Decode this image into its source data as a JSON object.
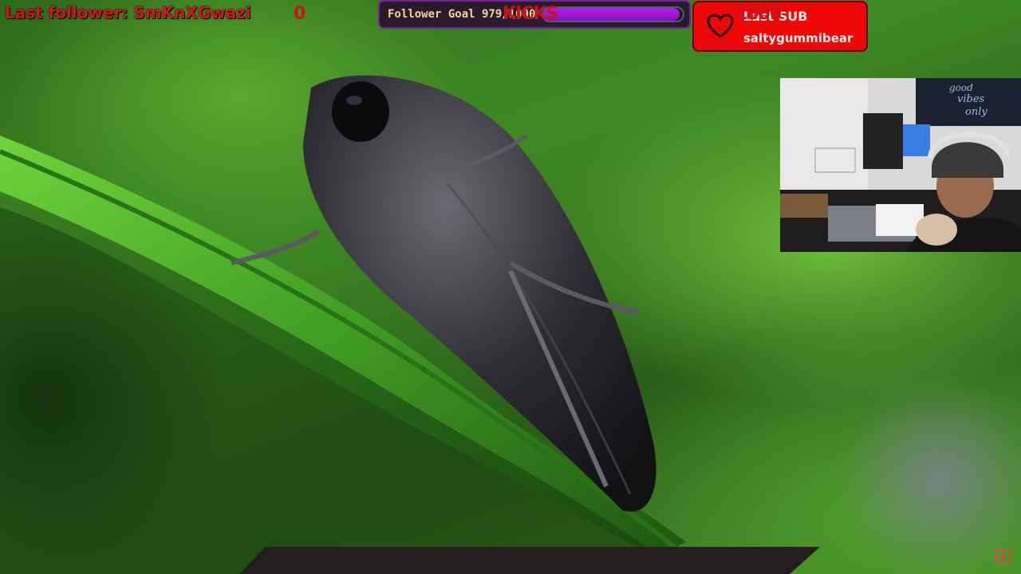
{
  "overlay": {
    "last_follower": "Last follower: SmKnXGwazi",
    "follower_goal": {
      "label": "Follower Goal 979/1000",
      "current": 979,
      "target": 1000,
      "progress_fraction": 0.979
    },
    "last_sub": {
      "title": "Last SUB",
      "name": "saltygummibear"
    },
    "kicks": {
      "left_value": "0",
      "label": "KICKS",
      "right_value": "1000"
    }
  },
  "webcam": {
    "sign_text_line1": "good",
    "sign_text_line2": "vibes",
    "sign_text_line3": "only"
  },
  "colors": {
    "follower_text": "#d0161b",
    "goal_fill": "#a21ad8",
    "sub_box": "#ee0707",
    "kicks_text": "#c7141a"
  },
  "icons": {
    "heart": "heart-icon",
    "youtube": "youtube-icon"
  }
}
